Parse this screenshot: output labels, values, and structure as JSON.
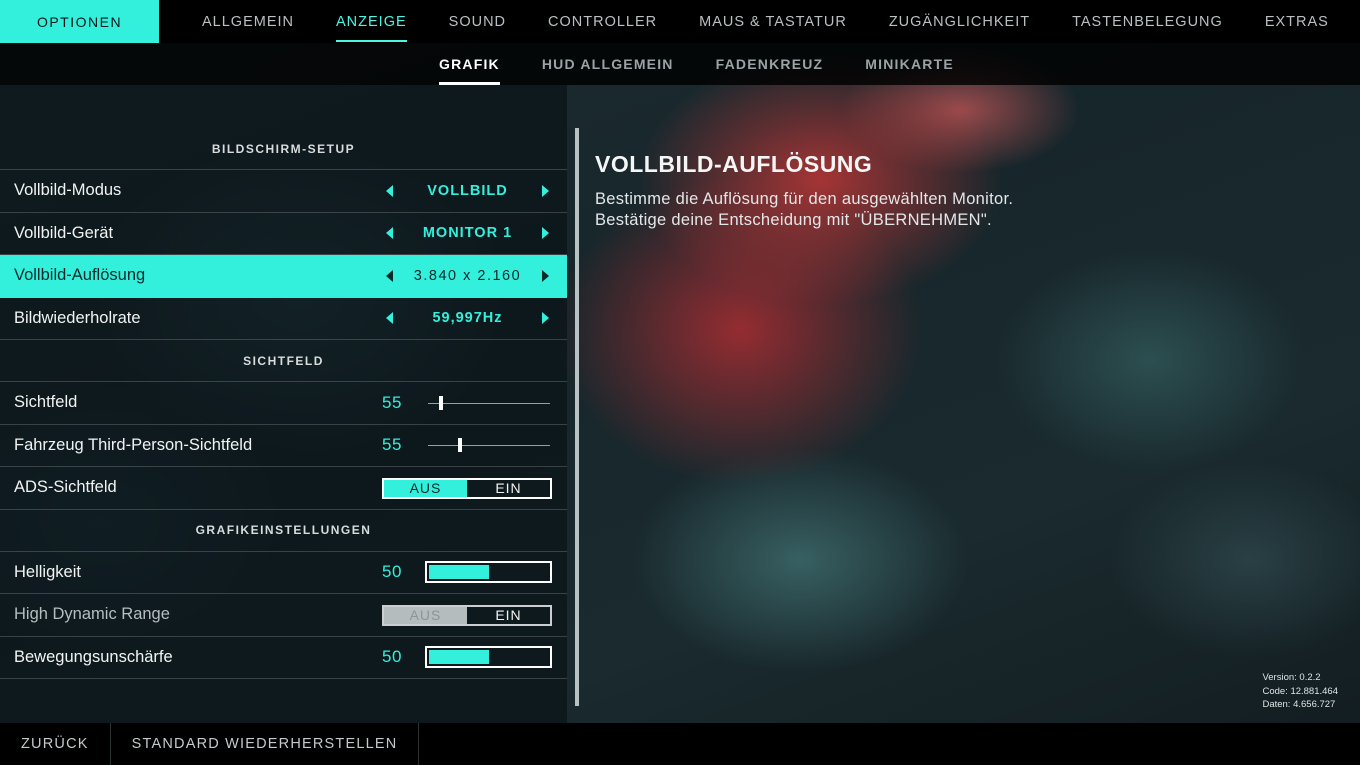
{
  "top_nav": {
    "title": "OPTIONEN",
    "tabs": [
      {
        "label": "ALLGEMEIN",
        "active": false
      },
      {
        "label": "ANZEIGE",
        "active": true
      },
      {
        "label": "SOUND",
        "active": false
      },
      {
        "label": "CONTROLLER",
        "active": false
      },
      {
        "label": "MAUS & TASTATUR",
        "active": false
      },
      {
        "label": "ZUGÄNGLICHKEIT",
        "active": false
      },
      {
        "label": "TASTENBELEGUNG",
        "active": false
      },
      {
        "label": "EXTRAS",
        "active": false
      }
    ]
  },
  "sub_nav": {
    "tabs": [
      {
        "label": "GRAFIK",
        "active": true
      },
      {
        "label": "HUD ALLGEMEIN",
        "active": false
      },
      {
        "label": "FADENKREUZ",
        "active": false
      },
      {
        "label": "MINIKARTE",
        "active": false
      }
    ]
  },
  "settings": {
    "bildschirm_setup": {
      "header": "BILDSCHIRM-SETUP",
      "vollbild_modus": {
        "label": "Vollbild-Modus",
        "value": "VOLLBILD"
      },
      "vollbild_geraet": {
        "label": "Vollbild-Gerät",
        "value": "MONITOR 1"
      },
      "vollbild_aufloesung": {
        "label": "Vollbild-Auflösung",
        "value": "3.840 x 2.160",
        "selected": true
      },
      "bildwiederholrate": {
        "label": "Bildwiederholrate",
        "value": "59,997Hz"
      }
    },
    "sichtfeld": {
      "header": "SICHTFELD",
      "sichtfeld": {
        "label": "Sichtfeld",
        "value": "55",
        "slider_fraction": 0.11
      },
      "fahrzeug_sichtfeld": {
        "label": "Fahrzeug Third-Person-Sichtfeld",
        "value": "55",
        "slider_fraction": 0.26
      },
      "ads_sichtfeld": {
        "label": "ADS-Sichtfeld",
        "off": "AUS",
        "on": "EIN",
        "state": "AUS"
      }
    },
    "grafik": {
      "header": "GRAFIKEINSTELLUNGEN",
      "helligkeit": {
        "label": "Helligkeit",
        "value": "50",
        "fill_fraction": 0.5
      },
      "hdr": {
        "label": "High Dynamic Range",
        "off": "AUS",
        "on": "EIN",
        "state": "AUS",
        "disabled": true
      },
      "bewegungsunschaerfe": {
        "label": "Bewegungsunschärfe",
        "value": "50",
        "fill_fraction": 0.5
      }
    }
  },
  "info": {
    "title": "VOLLBILD-AUFLÖSUNG",
    "line1": "Bestimme die Auflösung für den ausgewählten Monitor.",
    "line2": "Bestätige deine Entscheidung mit \"ÜBERNEHMEN\"."
  },
  "version_info": {
    "version": "Version: 0.2.2",
    "code": "Code: 12.881.464",
    "daten": "Daten: 4.656.727"
  },
  "bottom": {
    "back": "ZURÜCK",
    "reset": "STANDARD WIEDERHERSTELLEN"
  },
  "colors": {
    "accent": "#33f0dc",
    "background": "#000000"
  }
}
